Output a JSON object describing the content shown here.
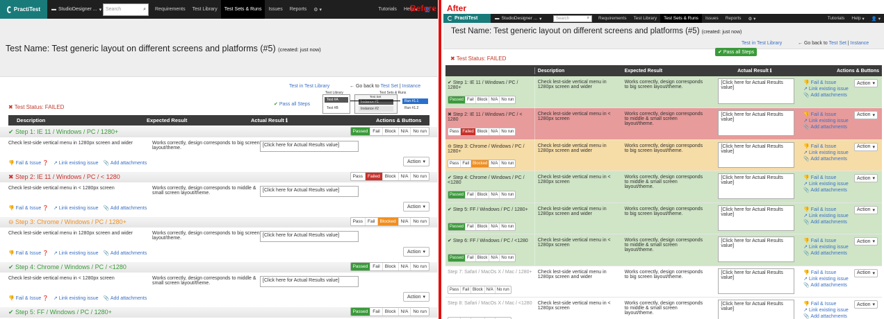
{
  "labels": {
    "before": "Before",
    "after": "After"
  },
  "colors": {
    "pass": "#3a9a3a",
    "fail": "#c9302c",
    "blocked": "#ef8e1f",
    "divider": "#e01010",
    "nav": "#1f1f1f"
  },
  "nav": {
    "logo": "PractiTest",
    "project": "StudioDesigner ...",
    "search_placeholder": "Search",
    "items": [
      "Requirements",
      "Test Library",
      "Test Sets & Runs",
      "Issues",
      "Reports"
    ],
    "right": [
      "Tutorials",
      "Help"
    ]
  },
  "test": {
    "title": "Test Name: Test generic layout on different screens and platforms (#5)",
    "created": "(created: just now)",
    "status": "Test Status: FAILED",
    "link_library": "Test in Test Library",
    "go_back": "Go back to",
    "test_set": "Test Set",
    "instance": "Instance",
    "pass_all": "Pass all Steps"
  },
  "mini_diagram": {
    "test_library": "Test Library",
    "test_sets_runs": "Test Sets & Runs",
    "test_set": "Test Set",
    "test_a": "Test #A",
    "test_b": "Test #B",
    "instance1": "Instance #1",
    "instance2": "Instance #2",
    "run1": "Run #1.1",
    "run2": "Run #1.2"
  },
  "columns": {
    "description": "Description",
    "expected": "Expected Result",
    "actual": "Actual Result",
    "actions": "Actions & Buttons"
  },
  "status_labels": {
    "pass": "Pass",
    "passed": "Passed",
    "fail": "Fail",
    "failed": "Failed",
    "block": "Block",
    "blocked": "Blocked",
    "na": "N/A",
    "norun": "No run"
  },
  "step_actions": {
    "fail_issue": "Fail & Issue",
    "link_issue": "Link existing issue",
    "attach": "Add attachments",
    "action": "Action"
  },
  "actual_placeholder": "[Click here for Actual Results value]",
  "left_steps": [
    {
      "title": "Step 1: IE 11 / Windows / PC / 1280+",
      "status": "passed",
      "desc": "Check lest-side vertical menu in 1280px screen and wider",
      "expected": "Works correctly, design corresponds to big screen layout/theme."
    },
    {
      "title": "Step 2: IE 11 / Windows / PC / < 1280",
      "status": "failed",
      "desc": "Check lest-side vertical menu in < 1280px screen",
      "expected": "Works correctly, design corresponds to middle & small screen layout/theme."
    },
    {
      "title": "Step 3: Chrome / Windows / PC / 1280+",
      "status": "blocked",
      "desc": "Check lest-side vertical menu in 1280px screen and wider",
      "expected": "Works correctly, design corresponds to big screen layout/theme."
    },
    {
      "title": "Step 4: Chrome / Windows / PC / <1280",
      "status": "passed",
      "desc": "Check lest-side vertical menu in < 1280px screen",
      "expected": "Works correctly, design corresponds to middle & small screen layout/theme."
    },
    {
      "title": "Step 5: FF / Windows / PC / 1280+",
      "status": "passed",
      "desc": "",
      "expected": ""
    }
  ],
  "right_steps": [
    {
      "title": "Step 1: IE 11 / Windows / PC / 1280+",
      "status": "passed",
      "desc": "Check lest-side vertical menu in 1280px screen and wider",
      "expected": "Works correctly, design corresponds to big screen layout/theme."
    },
    {
      "title": "Step 2: IE 11 / Windows / PC / < 1280",
      "status": "failed",
      "desc": "Check lest-side vertical menu in < 1280px screen",
      "expected": "Works correctly, design corresponds to middle & small screen layout/theme."
    },
    {
      "title": "Step 3: Chrome / Windows / PC / 1280+",
      "status": "blocked",
      "desc": "Check lest-side vertical menu in 1280px screen and wider",
      "expected": "Works correctly, design corresponds to big screen layout/theme."
    },
    {
      "title": "Step 4: Chrome / Windows / PC / <1280",
      "status": "passed",
      "desc": "Check lest-side vertical menu in < 1280px screen",
      "expected": "Works correctly, design corresponds to middle & small screen layout/theme."
    },
    {
      "title": "Step 5: FF / Windows / PC / 1280+",
      "status": "passed",
      "desc": "Check lest-side vertical menu in 1280px screen and wider",
      "expected": "Works correctly, design corresponds to big screen layout/theme."
    },
    {
      "title": "Step 6: FF / Windows / PC / <1280",
      "status": "passed",
      "desc": "Check lest-side vertical menu in < 1280px screen",
      "expected": "Works correctly, design corresponds to middle & small screen layout/theme."
    },
    {
      "title": "Step 7: Safari / MacOs X / Mac / 1280+",
      "status": "norun",
      "desc": "Check lest-side vertical menu in 1280px screen and wider",
      "expected": "Works correctly, design corresponds to big screen layout/theme."
    },
    {
      "title": "Step 8: Safari / MacOs X / Mac / <1280",
      "status": "norun",
      "desc": "Check lest-side vertical menu in < 1280px screen",
      "expected": "Works correctly, design corresponds to middle & small screen layout/theme."
    }
  ]
}
